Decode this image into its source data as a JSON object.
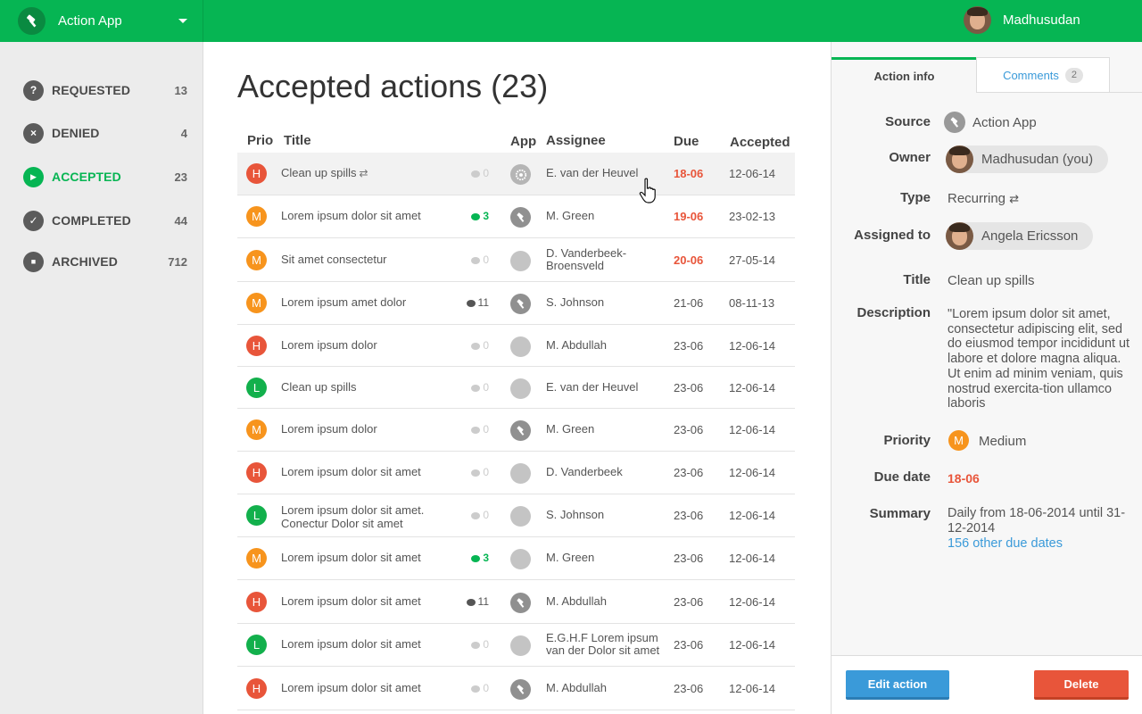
{
  "header": {
    "app_name": "Action App",
    "user_name": "Madhusudan"
  },
  "sidebar": {
    "items": [
      {
        "icon": "?",
        "label": "REQUESTED",
        "count": "13"
      },
      {
        "icon": "×",
        "label": "DENIED",
        "count": "4"
      },
      {
        "icon": "▶",
        "label": "ACCEPTED",
        "count": "23",
        "active": true
      },
      {
        "icon": "✓",
        "label": "COMPLETED",
        "count": "44"
      },
      {
        "icon": "■",
        "label": "ARCHIVED",
        "count": "712"
      }
    ]
  },
  "main": {
    "title": "Accepted actions (23)",
    "columns": {
      "prio": "Prio",
      "title": "Title",
      "app": "App",
      "assignee": "Assignee",
      "due": "Due",
      "accepted": "Accepted"
    },
    "rows": [
      {
        "prio": "H",
        "title": "Clean up spills",
        "recurring": true,
        "comments": "0",
        "app": "gear",
        "assignee": "E. van der Heuvel",
        "due": "18-06",
        "due_overdue": true,
        "accepted": "12-06-14",
        "selected": true
      },
      {
        "prio": "M",
        "title": "Lorem ipsum dolor sit amet",
        "comments": "3",
        "comments_new": true,
        "app": "hammer",
        "assignee": "M. Green",
        "due": "19-06",
        "due_overdue": true,
        "accepted": "23-02-13"
      },
      {
        "prio": "M",
        "title": "Sit amet consectetur",
        "comments": "0",
        "app": "plain",
        "assignee": "D. Vanderbeek-Broensveld",
        "due": "20-06",
        "due_overdue": true,
        "accepted": "27-05-14"
      },
      {
        "prio": "M",
        "title": "Lorem ipsum amet dolor",
        "comments": "11",
        "app": "hammer",
        "assignee": "S. Johnson",
        "due": "21-06",
        "accepted": "08-11-13"
      },
      {
        "prio": "H",
        "title": "Lorem ipsum dolor",
        "comments": "0",
        "app": "plain",
        "assignee": "M. Abdullah",
        "due": "23-06",
        "accepted": "12-06-14"
      },
      {
        "prio": "L",
        "title": "Clean up spills",
        "comments": "0",
        "app": "plain",
        "assignee": "E. van der Heuvel",
        "due": "23-06",
        "accepted": "12-06-14"
      },
      {
        "prio": "M",
        "title": "Lorem ipsum dolor",
        "comments": "0",
        "app": "hammer",
        "assignee": "M. Green",
        "due": "23-06",
        "accepted": "12-06-14"
      },
      {
        "prio": "H",
        "title": "Lorem ipsum dolor sit amet",
        "comments": "0",
        "app": "plain",
        "assignee": "D. Vanderbeek",
        "due": "23-06",
        "accepted": "12-06-14"
      },
      {
        "prio": "L",
        "title": "Lorem ipsum dolor sit amet. Conectur Dolor sit amet",
        "comments": "0",
        "app": "plain",
        "assignee": "S. Johnson",
        "due": "23-06",
        "accepted": "12-06-14"
      },
      {
        "prio": "M",
        "title": "Lorem ipsum dolor sit amet",
        "comments": "3",
        "comments_new": true,
        "app": "plain",
        "assignee": "M. Green",
        "due": "23-06",
        "accepted": "12-06-14"
      },
      {
        "prio": "H",
        "title": "Lorem ipsum dolor sit amet",
        "comments": "11",
        "app": "hammer",
        "assignee": "M. Abdullah",
        "due": "23-06",
        "accepted": "12-06-14"
      },
      {
        "prio": "L",
        "title": "Lorem ipsum dolor sit amet",
        "comments": "0",
        "app": "plain",
        "assignee": "E.G.H.F Lorem ipsum van der Dolor sit amet",
        "due": "23-06",
        "accepted": "12-06-14"
      },
      {
        "prio": "H",
        "title": "Lorem ipsum dolor sit amet",
        "comments": "0",
        "app": "hammer",
        "assignee": "M. Abdullah",
        "due": "23-06",
        "accepted": "12-06-14"
      }
    ]
  },
  "panel": {
    "tabs": {
      "info": "Action info",
      "comments": "Comments",
      "comments_count": "2"
    },
    "labels": {
      "source": "Source",
      "owner": "Owner",
      "type": "Type",
      "assigned_to": "Assigned to",
      "title": "Title",
      "description": "Description",
      "priority": "Priority",
      "due_date": "Due date",
      "summary": "Summary"
    },
    "source": "Action App",
    "owner": "Madhusudan (you)",
    "type": "Recurring",
    "assigned_to": "Angela Ericsson",
    "title": "Clean up spills",
    "description": "\"Lorem ipsum dolor sit amet, consectetur adipiscing elit, sed do eiusmod tempor incididunt ut labore et dolore magna aliqua. Ut enim ad minim veniam, quis nostrud exercita-tion ullamco laboris",
    "priority_letter": "M",
    "priority": "Medium",
    "due_date": "18-06",
    "summary": "Daily from 18-06-2014 until 31-12-2014",
    "summary_link": "156 other due dates",
    "buttons": {
      "edit": "Edit action",
      "delete": "Delete"
    }
  },
  "colors": {
    "brand_green": "#06b553",
    "prio_high": "#e8553a",
    "prio_medium": "#f7941d",
    "prio_low": "#12b04c",
    "link_blue": "#3a9ad9",
    "danger": "#e8553a"
  }
}
